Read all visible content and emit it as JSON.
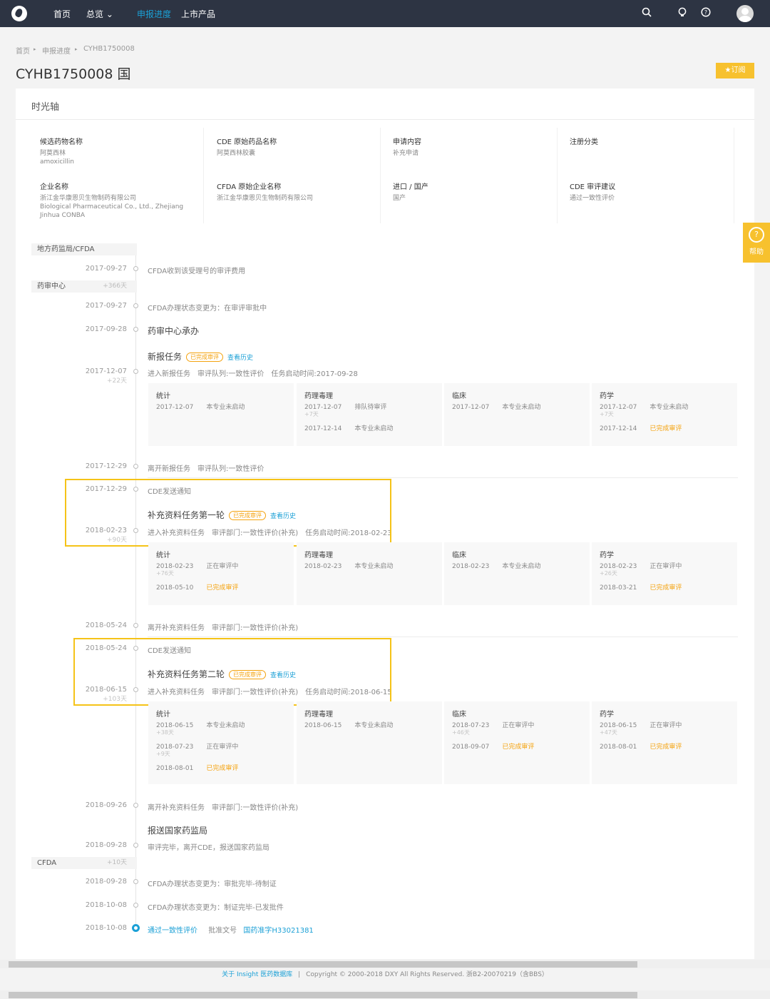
{
  "topbar": {
    "nav": [
      "首页",
      "总览 ⌄",
      "申报进度",
      "上市产品"
    ],
    "active": "申报进度"
  },
  "breadcrumb": [
    "首页",
    "申报进度",
    "CYHB1750008"
  ],
  "page": {
    "title": "CYHB1750008 国",
    "subscribe": "订阅",
    "help": "帮助"
  },
  "panel_title": "时光轴",
  "info": [
    {
      "label": "候选药物名称",
      "values": [
        "阿莫西林",
        "amoxicillin"
      ]
    },
    {
      "label": "CDE 原始药品名称",
      "values": [
        "阿莫西林胶囊"
      ]
    },
    {
      "label": "申请内容",
      "values": [
        "补充申请"
      ]
    },
    {
      "label": "注册分类",
      "values": []
    },
    {
      "label": "企业名称",
      "values": [
        "浙江金华康恩贝生物制药有限公司",
        "Biological Pharmaceutical Co., Ltd., Zhejiang Jinhua CONBA"
      ]
    },
    {
      "label": "CFDA 原始企业名称",
      "values": [
        "浙江金华康恩贝生物制药有限公司"
      ]
    },
    {
      "label": "进口 / 国产",
      "values": [
        "国产"
      ]
    },
    {
      "label": "CDE 审评建议",
      "values": [
        "通过一致性评价"
      ]
    }
  ],
  "sections": [
    {
      "label": "地方药监局/CFDA",
      "plus": ""
    },
    {
      "label": "药审中心",
      "plus": "+366天"
    },
    {
      "label": "CFDA",
      "plus": "+10天"
    }
  ],
  "events": [
    {
      "date": "2017-09-27",
      "text": "CFDA收到该受理号的审评费用"
    },
    {
      "date": "2017-09-27",
      "text": "CFDA办理状态变更为：在审评审批中"
    },
    {
      "date": "2017-09-28",
      "text": "药审中心承办"
    },
    {
      "date": "2017-12-07",
      "delta": "+22天",
      "task": "新报任务",
      "badge": "已完成审评",
      "link": "查看历史",
      "text": "进入新报任务　审评队列:一致性评价　任务启动时间:2017-09-28"
    },
    {
      "date": "2017-12-29",
      "text": "离开新报任务　审评队列:一致性评价"
    },
    {
      "date": "2017-12-29",
      "text": "CDE发送通知"
    },
    {
      "date": "2018-02-23",
      "delta": "+90天",
      "task": "补充资料任务第一轮",
      "badge": "已完成审评",
      "link": "查看历史",
      "text": "进入补充资料任务　审评部门:一致性评价(补充)　任务启动时间:2018-02-23"
    },
    {
      "date": "2018-05-24",
      "text": "离开补充资料任务　审评部门:一致性评价(补充)"
    },
    {
      "date": "2018-05-24",
      "text": "CDE发送通知"
    },
    {
      "date": "2018-06-15",
      "delta": "+103天",
      "task": "补充资料任务第二轮",
      "badge": "已完成审评",
      "link": "查看历史",
      "text": "进入补充资料任务　审评部门:一致性评价(补充)　任务启动时间:2018-06-15"
    },
    {
      "date": "2018-09-26",
      "text": "离开补充资料任务　审评部门:一致性评价(补充)"
    },
    {
      "date": "2018-09-28",
      "title": "报送国家药监局",
      "text": "审评完毕，离开CDE，报送国家药监局"
    },
    {
      "date": "2018-09-28",
      "text": "CFDA办理状态变更为：审批完毕-待制证"
    },
    {
      "date": "2018-10-08",
      "text": "CFDA办理状态变更为：制证完毕-已发批件"
    },
    {
      "date": "2018-10-08",
      "result": "通过一致性评价",
      "approval_label": "批准文号",
      "approval": "国药准字H33021381"
    }
  ],
  "stages": [
    [
      {
        "name": "统计",
        "rows": [
          {
            "d": "2017-12-07",
            "s": "本专业未启动"
          }
        ]
      },
      {
        "name": "药理毒理",
        "rows": [
          {
            "d": "2017-12-07",
            "pd": "+7天",
            "s": "排队待审评"
          },
          {
            "d": "2017-12-14",
            "s": "本专业未启动"
          }
        ]
      },
      {
        "name": "临床",
        "rows": [
          {
            "d": "2017-12-07",
            "s": "本专业未启动"
          }
        ]
      },
      {
        "name": "药学",
        "rows": [
          {
            "d": "2017-12-07",
            "pd": "+7天",
            "s": "本专业未启动"
          },
          {
            "d": "2017-12-14",
            "s": "已完成审评",
            "done": true
          }
        ]
      }
    ],
    [
      {
        "name": "统计",
        "rows": [
          {
            "d": "2018-02-23",
            "pd": "+76天",
            "s": "正在审评中"
          },
          {
            "d": "2018-05-10",
            "s": "已完成审评",
            "done": true
          }
        ]
      },
      {
        "name": "药理毒理",
        "rows": [
          {
            "d": "2018-02-23",
            "s": "本专业未启动"
          }
        ]
      },
      {
        "name": "临床",
        "rows": [
          {
            "d": "2018-02-23",
            "s": "本专业未启动"
          }
        ]
      },
      {
        "name": "药学",
        "rows": [
          {
            "d": "2018-02-23",
            "pd": "+26天",
            "s": "正在审评中"
          },
          {
            "d": "2018-03-21",
            "s": "已完成审评",
            "done": true
          }
        ]
      }
    ],
    [
      {
        "name": "统计",
        "rows": [
          {
            "d": "2018-06-15",
            "pd": "+38天",
            "s": "本专业未启动"
          },
          {
            "d": "2018-07-23",
            "pd": "+9天",
            "s": "正在审评中"
          },
          {
            "d": "2018-08-01",
            "s": "已完成审评",
            "done": true
          }
        ]
      },
      {
        "name": "药理毒理",
        "rows": [
          {
            "d": "2018-06-15",
            "s": "本专业未启动"
          }
        ]
      },
      {
        "name": "临床",
        "rows": [
          {
            "d": "2018-07-23",
            "pd": "+46天",
            "s": "正在审评中"
          },
          {
            "d": "2018-09-07",
            "s": "已完成审评",
            "done": true
          }
        ]
      },
      {
        "name": "药学",
        "rows": [
          {
            "d": "2018-06-15",
            "pd": "+47天",
            "s": "正在审评中"
          },
          {
            "d": "2018-08-01",
            "s": "已完成审评",
            "done": true
          }
        ]
      }
    ]
  ],
  "footer": {
    "link": "关于 Insight 医药数据库",
    "sep": "|",
    "text": "Copyright © 2000-2018 DXY All Rights Reserved. 浙B2-20070219（含BBS）"
  },
  "colors": {
    "topbar": "#2d3443",
    "accent": "#1ba0d6",
    "orange": "#f4a20d",
    "highlight": "#f5c318"
  },
  "icons": [
    "logo-icon",
    "search-icon",
    "bulb-icon",
    "question-icon",
    "avatar-icon",
    "star-icon",
    "help-icon"
  ]
}
